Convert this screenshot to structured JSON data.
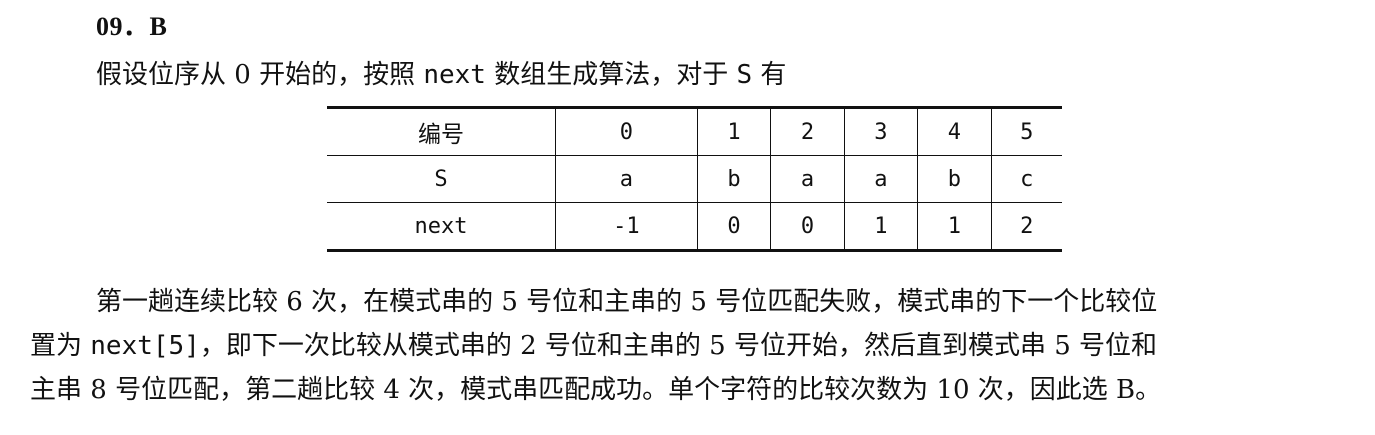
{
  "heading": "09．B",
  "intro": {
    "part1": "假设位序从 0 开始的，按照 ",
    "code": "next",
    "part2": " 数组生成算法，对于 ",
    "var": "S",
    "part3": " 有"
  },
  "table": {
    "rows": [
      {
        "label": "编号",
        "cells": [
          "0",
          "1",
          "2",
          "3",
          "4",
          "5"
        ]
      },
      {
        "label": "S",
        "cells": [
          "a",
          "b",
          "a",
          "a",
          "b",
          "c"
        ]
      },
      {
        "label": "next",
        "cells": [
          "-1",
          "0",
          "0",
          "1",
          "1",
          "2"
        ]
      }
    ]
  },
  "paragraph": {
    "line1": "第一趟连续比较 6 次，在模式串的 5 号位和主串的 5 号位匹配失败，模式串的下一个比较位",
    "line2_pre": "置为 ",
    "line2_code": "next[5]",
    "line2_post": "，即下一次比较从模式串的 2 号位和主串的 5 号位开始，然后直到模式串 5 号位和",
    "line3": "主串 8 号位匹配，第二趟比较 4 次，模式串匹配成功。单个字符的比较次数为 10 次，因此选 B。"
  }
}
